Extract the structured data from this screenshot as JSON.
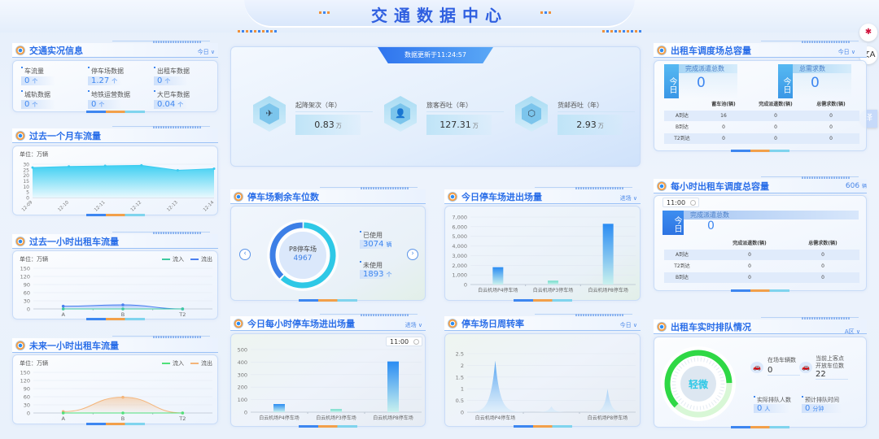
{
  "header": {
    "title": "交通数据中心"
  },
  "side_buttons": {
    "translate_label": "译"
  },
  "traffic_info": {
    "title": "交通实况信息",
    "dropdown": "今日",
    "items": [
      {
        "label": "车流量",
        "value": "0",
        "unit": "个"
      },
      {
        "label": "停车场数据",
        "value": "1.27",
        "unit": "个"
      },
      {
        "label": "出租车数据",
        "value": "0",
        "unit": "个"
      },
      {
        "label": "城轨数据",
        "value": "0",
        "unit": "个"
      },
      {
        "label": "地铁运营数据",
        "value": "0",
        "unit": "个"
      },
      {
        "label": "大巴车数据",
        "value": "0.04",
        "unit": "个"
      }
    ]
  },
  "monthly_flow": {
    "title": "过去一个月车流量",
    "unit": "单位：万辆"
  },
  "past_hour": {
    "title": "过去一小时出租车流量",
    "unit": "单位：万辆",
    "legend_in": "流入",
    "legend_out": "流出"
  },
  "next_hour": {
    "title": "未来一小时出租车流量",
    "unit": "单位：万辆",
    "legend_in": "流入",
    "legend_out": "流出"
  },
  "overview": {
    "update_badge": "数据更新于11:24:57",
    "stats": [
      {
        "label": "起降架次（年）",
        "value": "0.83",
        "unit": "万",
        "icon": "plane-icon"
      },
      {
        "label": "旅客吞吐（年）",
        "value": "127.31",
        "unit": "万",
        "icon": "passenger-icon"
      },
      {
        "label": "货邮吞吐（年）",
        "value": "2.93",
        "unit": "万",
        "icon": "cargo-box-icon"
      }
    ]
  },
  "parking_remaining": {
    "title": "停车场剩余车位数",
    "lot_name": "P8停车场",
    "total": "4967",
    "used_label": "已使用",
    "used_value": "3074",
    "used_unit": "辆",
    "unused_label": "未使用",
    "unused_value": "1893",
    "unused_unit": "个"
  },
  "parking_today": {
    "title": "今日停车场进出场量",
    "dropdown": "进场"
  },
  "parking_hourly": {
    "title": "今日每小时停车场进出场量",
    "dropdown": "进场",
    "time": "11:00"
  },
  "parking_turnover": {
    "title": "停车场日周转率",
    "dropdown": "今日"
  },
  "taxi_capacity": {
    "title": "出租车调度场总容量",
    "dropdown": "今日",
    "cards": [
      {
        "tab": "今日",
        "label": "完成派遣总数",
        "value": "0"
      },
      {
        "tab": "今日",
        "label": "总需求数",
        "value": "0"
      }
    ],
    "columns": [
      "",
      "蓄车池(辆)",
      "完成派遣数(辆)",
      "总需求数(辆)"
    ],
    "rows": [
      [
        "A到达",
        "16",
        "0",
        "0"
      ],
      [
        "B到达",
        "0",
        "0",
        "0"
      ],
      [
        "T2到达",
        "0",
        "0",
        "0"
      ]
    ]
  },
  "taxi_hourly": {
    "title": "每小时出租车调度总容量",
    "total": "606",
    "total_unit": "辆",
    "time": "11:00",
    "card": {
      "tab": "今日",
      "label": "完成派遣总数",
      "value": "0"
    },
    "columns": [
      "",
      "完成派遣数(辆)",
      "总需求数(辆)"
    ],
    "rows": [
      [
        "A到达",
        "0",
        "0"
      ],
      [
        "T2到达",
        "0",
        "0"
      ],
      [
        "B到达",
        "0",
        "0"
      ]
    ]
  },
  "taxi_queue": {
    "title": "出租车实时排队情况",
    "dropdown": "A区",
    "status": "轻微",
    "gauge_fraction": 0.62,
    "on_site_label": "在场车辆数",
    "on_site_value": "0",
    "open_slots_label_1": "当前上客点",
    "open_slots_label_2": "开放车位数",
    "open_slots_value": "22",
    "queue_people_label": "实际排队人数",
    "queue_people_value": "0",
    "queue_people_unit": "人",
    "wait_label": "预计排队时间",
    "wait_value": "0",
    "wait_unit": "分钟"
  },
  "colors": {
    "accent": "#2a6ee8",
    "cyan": "#2ec8e6",
    "orange": "#f2a04a",
    "green": "#3ddc5a"
  },
  "chart_data": [
    {
      "id": "monthly",
      "type": "area",
      "title": "过去一个月车流量",
      "ylabel": "单位：万辆",
      "categories": [
        "12-09",
        "12-10",
        "12-11",
        "12-12",
        "12-13",
        "12-14"
      ],
      "values": [
        27,
        28,
        28.5,
        29,
        24.5,
        26
      ],
      "ylim": [
        0,
        30
      ],
      "yticks": [
        0,
        5,
        10,
        15,
        20,
        25,
        30
      ]
    },
    {
      "id": "past_hour",
      "type": "line",
      "title": "过去一小时出租车流量",
      "categories": [
        "A",
        "B",
        "T2"
      ],
      "ylim": [
        0,
        150
      ],
      "yticks": [
        0,
        30,
        60,
        90,
        120,
        150
      ],
      "series": [
        {
          "name": "流入",
          "color": "#3ec9a0",
          "values": [
            0,
            0,
            0
          ]
        },
        {
          "name": "流出",
          "color": "#4a7ff0",
          "values": [
            10,
            15,
            0
          ]
        }
      ]
    },
    {
      "id": "next_hour",
      "type": "line",
      "title": "未来一小时出租车流量",
      "categories": [
        "A",
        "B",
        "T2"
      ],
      "ylim": [
        0,
        150
      ],
      "yticks": [
        0,
        30,
        60,
        90,
        120,
        150
      ],
      "series": [
        {
          "name": "流入",
          "color": "#4fe07a",
          "values": [
            0,
            0,
            0
          ]
        },
        {
          "name": "流出",
          "color": "#f4b57a",
          "values": [
            5,
            58,
            0
          ]
        }
      ]
    },
    {
      "id": "parking_today",
      "type": "bar",
      "title": "今日停车场进出场量",
      "categories": [
        "白云机场P4停车场",
        "白云机场P3停车场",
        "白云机场P8停车场"
      ],
      "values": [
        1800,
        400,
        6300
      ],
      "ylim": [
        0,
        7000
      ],
      "yticks": [
        "0",
        "1,000",
        "2,000",
        "3,000",
        "4,000",
        "5,000",
        "6,000",
        "7,000"
      ]
    },
    {
      "id": "parking_hourly",
      "type": "bar",
      "title": "今日每小时停车场进出场量",
      "categories": [
        "白云机场P4停车场",
        "白云机场P3停车场",
        "白云机场P8停车场"
      ],
      "values": [
        65,
        25,
        405
      ],
      "ylim": [
        0,
        500
      ],
      "yticks": [
        "0",
        "100",
        "200",
        "300",
        "400",
        "500"
      ]
    },
    {
      "id": "parking_turnover",
      "type": "area",
      "title": "停车场日周转率",
      "categories": [
        "白云机场P4停车场",
        "",
        "白云机场P8停车场"
      ],
      "values": [
        2.2,
        0.25,
        1.0
      ],
      "ylim": [
        0,
        2.5
      ],
      "yticks": [
        "0",
        "0.5",
        "1",
        "1.5",
        "2",
        "2.5"
      ]
    },
    {
      "id": "parking_donut",
      "type": "pie",
      "title": "停车场剩余车位数",
      "slices": [
        {
          "name": "已使用",
          "value": 3074,
          "color": "#2ec8e6"
        },
        {
          "name": "未使用",
          "value": 1893,
          "color": "#3d7fe6"
        }
      ]
    }
  ]
}
